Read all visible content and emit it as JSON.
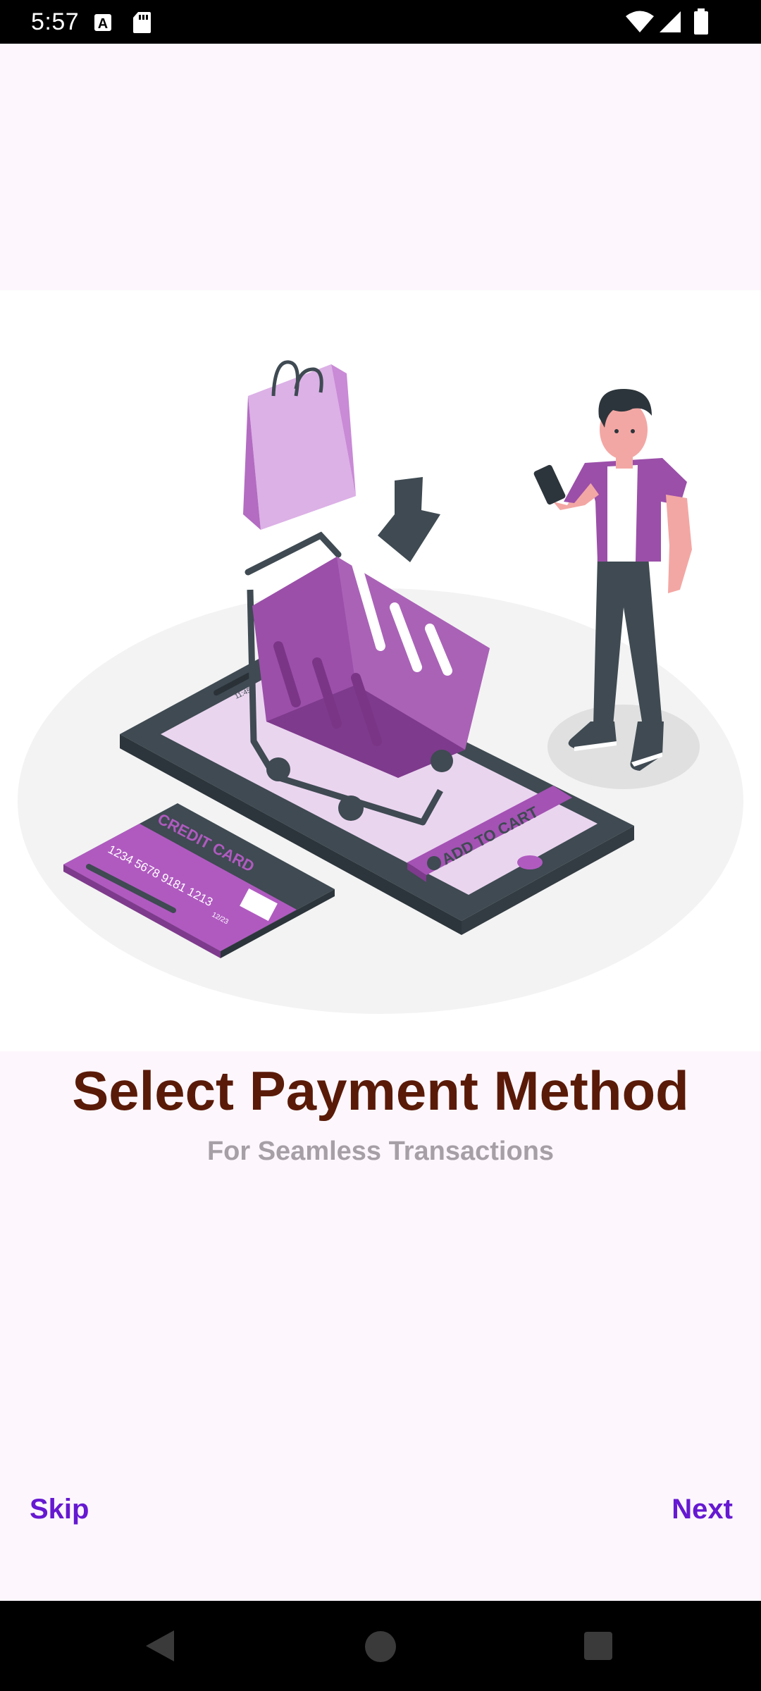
{
  "status_bar": {
    "time": "5:57",
    "icons": [
      "a-notification-icon",
      "sd-card-icon",
      "wifi-icon",
      "signal-icon",
      "battery-icon"
    ]
  },
  "illustration": {
    "credit_card_label": "CREDIT CARD",
    "card_number": "1234  5678  9181  1213",
    "card_expiry": "12/23",
    "add_to_cart_label": "ADD TO CART",
    "phone_clock": "11:45"
  },
  "onboarding": {
    "title": "Select Payment Method",
    "subtitle": "For Seamless Transactions"
  },
  "navigation": {
    "skip_label": "Skip",
    "next_label": "Next"
  },
  "colors": {
    "title": "#5a1a08",
    "accent": "#6619d1",
    "subtitle": "#a6a0a6",
    "background": "#fdf7fd",
    "illustration_purple": "#9b4fa9"
  }
}
